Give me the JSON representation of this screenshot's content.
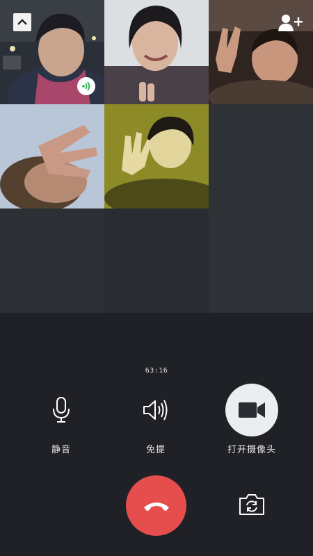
{
  "call": {
    "timer": "63:16"
  },
  "participants": [
    {
      "id": "p1",
      "speaking": true
    },
    {
      "id": "p2",
      "speaking": false
    },
    {
      "id": "p3",
      "speaking": false
    },
    {
      "id": "p4",
      "speaking": false
    },
    {
      "id": "p5",
      "speaking": false
    }
  ],
  "controls": {
    "mute_label": "静音",
    "speaker_label": "免提",
    "camera_label": "打开摄像头"
  },
  "icons": {
    "collapse": "chevron-up-icon",
    "add_member": "add-user-icon",
    "speaking": "voice-wave-icon",
    "mute": "microphone-icon",
    "speaker": "speaker-icon",
    "camera": "video-camera-icon",
    "hangup": "phone-hangup-icon",
    "switch_camera": "switch-camera-icon"
  },
  "colors": {
    "background": "#1f2126",
    "hangup": "#e64e4e",
    "speaking_indicator": "#22b24c",
    "camera_button": "#ecedee"
  }
}
